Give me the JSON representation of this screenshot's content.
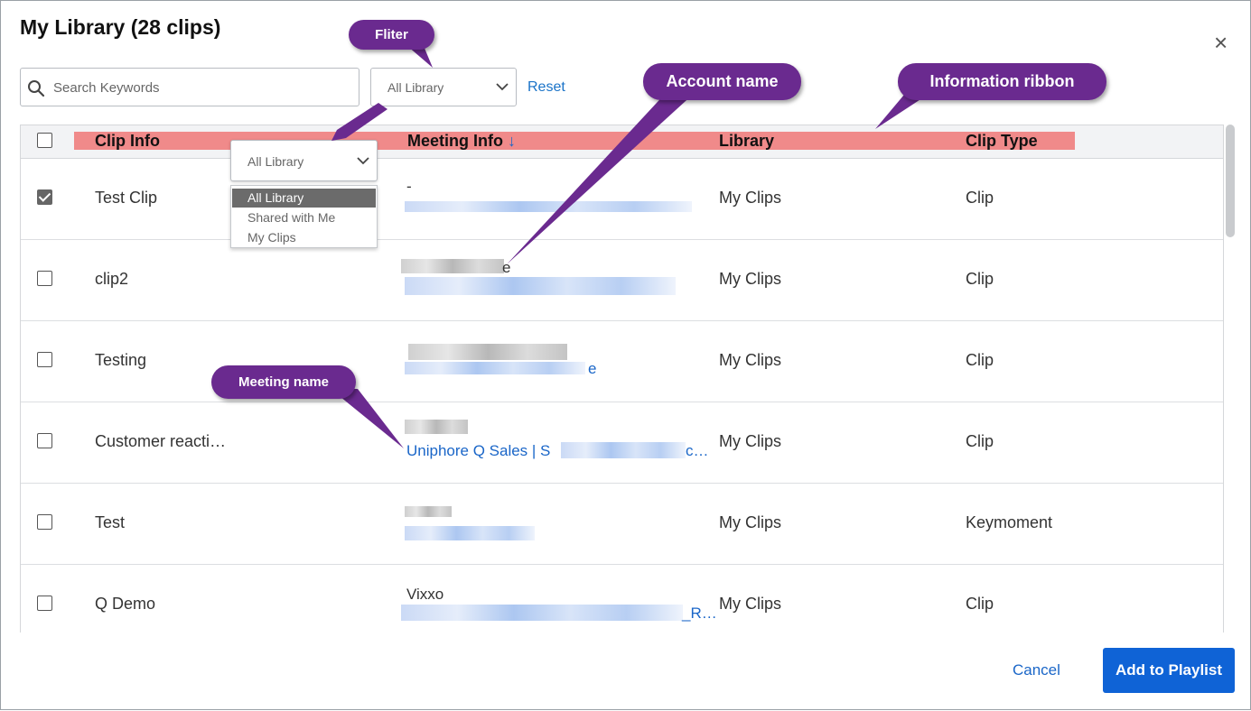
{
  "dialog": {
    "title": "My Library (28 clips)",
    "close_symbol": "×"
  },
  "filters": {
    "search_placeholder": "Search Keywords",
    "library_select_value": "All Library",
    "reset_label": "Reset"
  },
  "table": {
    "headers": {
      "clip_info": "Clip Info",
      "meeting_info": "Meeting Info",
      "sort_arrow": "↓",
      "library": "Library",
      "clip_type": "Clip Type"
    },
    "rows": [
      {
        "checked": true,
        "clip": "Test Clip",
        "account": "-",
        "meeting": "",
        "library": "My Clips",
        "type": "Clip"
      },
      {
        "checked": false,
        "clip": "clip2",
        "account": "e",
        "meeting": "",
        "library": "My Clips",
        "type": "Clip"
      },
      {
        "checked": false,
        "clip": "Testing",
        "account": "",
        "meeting": "e",
        "library": "My Clips",
        "type": "Clip"
      },
      {
        "checked": false,
        "clip": "Customer reacti…",
        "account": "",
        "meeting": "Uniphore Q Sales | S",
        "library": "My Clips",
        "type": "Clip"
      },
      {
        "checked": false,
        "clip": "Test",
        "account": "",
        "meeting": "",
        "library": "My Clips",
        "type": "Keymoment"
      },
      {
        "checked": false,
        "clip": "Q Demo",
        "account": "Vixxo",
        "meeting": "_R…",
        "library": "My Clips",
        "type": "Clip"
      }
    ]
  },
  "dropdown": {
    "value": "All Library",
    "options": [
      "All Library",
      "Shared with Me",
      "My Clips"
    ],
    "selected_index": 0
  },
  "callouts": {
    "filter": "Fliter",
    "account": "Account name",
    "ribbon": "Information ribbon",
    "meeting": "Meeting name"
  },
  "footer": {
    "cancel_label": "Cancel",
    "add_label": "Add to Playlist"
  },
  "colors": {
    "accent": "#0f63d6",
    "callout": "#6a2a8f",
    "ribbon": "#f08a8a"
  }
}
